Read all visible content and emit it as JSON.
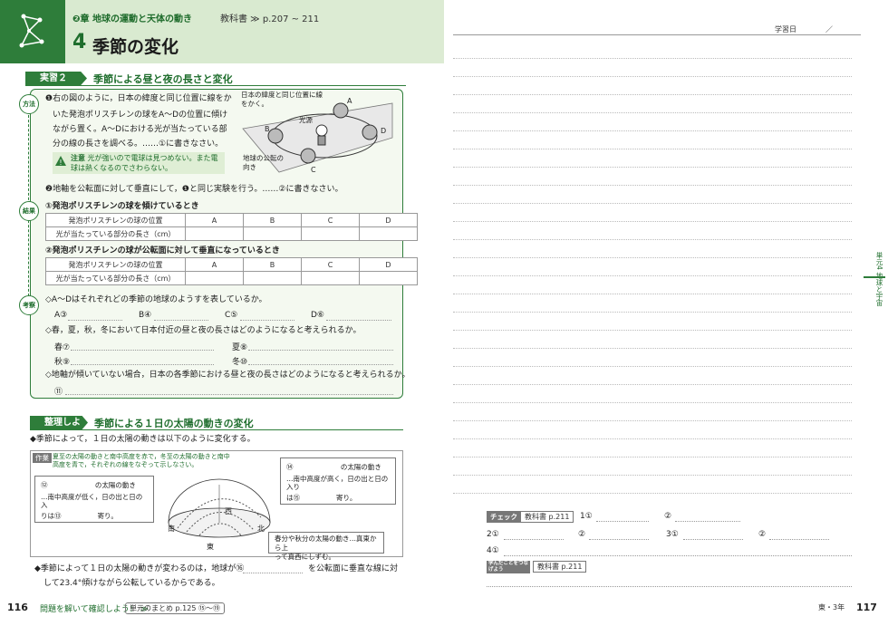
{
  "header": {
    "chapter": "❷章 地球の運動と天体の動き",
    "textbook": "教科書 ≫ p.207 ~ 211",
    "number": "4",
    "title": "季節の変化"
  },
  "experiment": {
    "tag": "実習２",
    "title": "季節による昼と夜の長さと変化",
    "labels": {
      "method": "方法",
      "result": "結果",
      "discussion": "考察"
    },
    "step1": [
      "❶右の図のように，日本の緯度と同じ位置に線をか",
      "いた発泡ポリスチレンの球をA～Dの位置に傾け",
      "ながら置く。A～Dにおける光が当たっている部",
      "分の線の長さを調べる。……①に書きなさい。"
    ],
    "warning_tag": "注意",
    "warning": "光が強いので電球は見つめない。また電球は熱くなるのでさわらない。",
    "figure": {
      "lat_label": "日本の緯度と同じ位置に線をかく。",
      "orbit_label": "地球の公転の向き",
      "light": "光源",
      "A": "A",
      "B": "B",
      "C": "C",
      "D": "D"
    },
    "step2": "❷地軸を公転面に対して垂直にして，❶と同じ実験を行う。……②に書きなさい。",
    "result1_title": "①発泡ポリスチレンの球を傾けているとき",
    "result2_title": "②発泡ポリスチレンの球が公転面に対して垂直になっているとき",
    "table_rows": [
      "発泡ポリスチレンの球の位置",
      "光が当たっている部分の長さ（cm）"
    ],
    "table_cols": [
      "A",
      "B",
      "C",
      "D"
    ],
    "q1": "◇A～Dはそれぞれどの季節の地球のようすを表しているか。",
    "q1_blanks": [
      "A③",
      "B④",
      "C⑤",
      "D⑥"
    ],
    "q2": "◇春，夏，秋，冬において日本付近の昼と夜の長さはどのようになると考えられるか。",
    "q2_blanks": [
      "春⑦",
      "夏⑧",
      "秋⑨",
      "冬⑩"
    ],
    "q3": "◇地軸が傾いていない場合，日本の各季節における昼と夜の長さはどのようになると考えられるか。",
    "q3_blank": "⑪"
  },
  "organize": {
    "tag": "整理しよう",
    "title": "季節による１日の太陽の動きの変化",
    "lead": "◆季節によって，１日の太陽の動きは以下のように変化する。",
    "work_tag": "作業",
    "work_text": "夏至の太陽の動きと南中高度を赤で，冬至の太陽の動きと南中高度を青で，それぞれの線をなぞって示しなさい。",
    "c12": [
      "⑫",
      "の太陽の動き",
      "…南中高度が低く，日の出と日の入",
      "りは⑬",
      "寄り。"
    ],
    "c14": [
      "⑭",
      "の太陽の動き",
      "…南中高度が高く，日の出と日の入り",
      "は⑮",
      "寄り。"
    ],
    "c_eq": [
      "春分や秋分の太陽の動き…真東から上",
      "って真西にしずむ。"
    ],
    "dirs": {
      "S": "南",
      "N": "北",
      "E": "東",
      "W": "西"
    },
    "summary": [
      "◆季節によって１日の太陽の動きが変わるのは，地球が⑯",
      "を公転面に垂直な線に対",
      "して23.4°傾けながら公転しているからである。"
    ]
  },
  "footer": {
    "left_page": "116",
    "hint": "問題を解いて確認しよう！ ≫",
    "summary_ref": "単元のまとめ p.125 ⑮～⑲",
    "right_page": "117",
    "grade": "東・3年"
  },
  "right": {
    "study_date": "学習日　　　　／",
    "tab": "単元4 地球と宇宙",
    "check_tag": "チェック",
    "check_ref": "教科書 p.211",
    "check_items": [
      "1①",
      "②",
      "2①",
      "②",
      "3①",
      "②",
      "4①"
    ],
    "learned_tag": "学んだことをつなげよう",
    "learned_ref": "教科書 p.211"
  }
}
